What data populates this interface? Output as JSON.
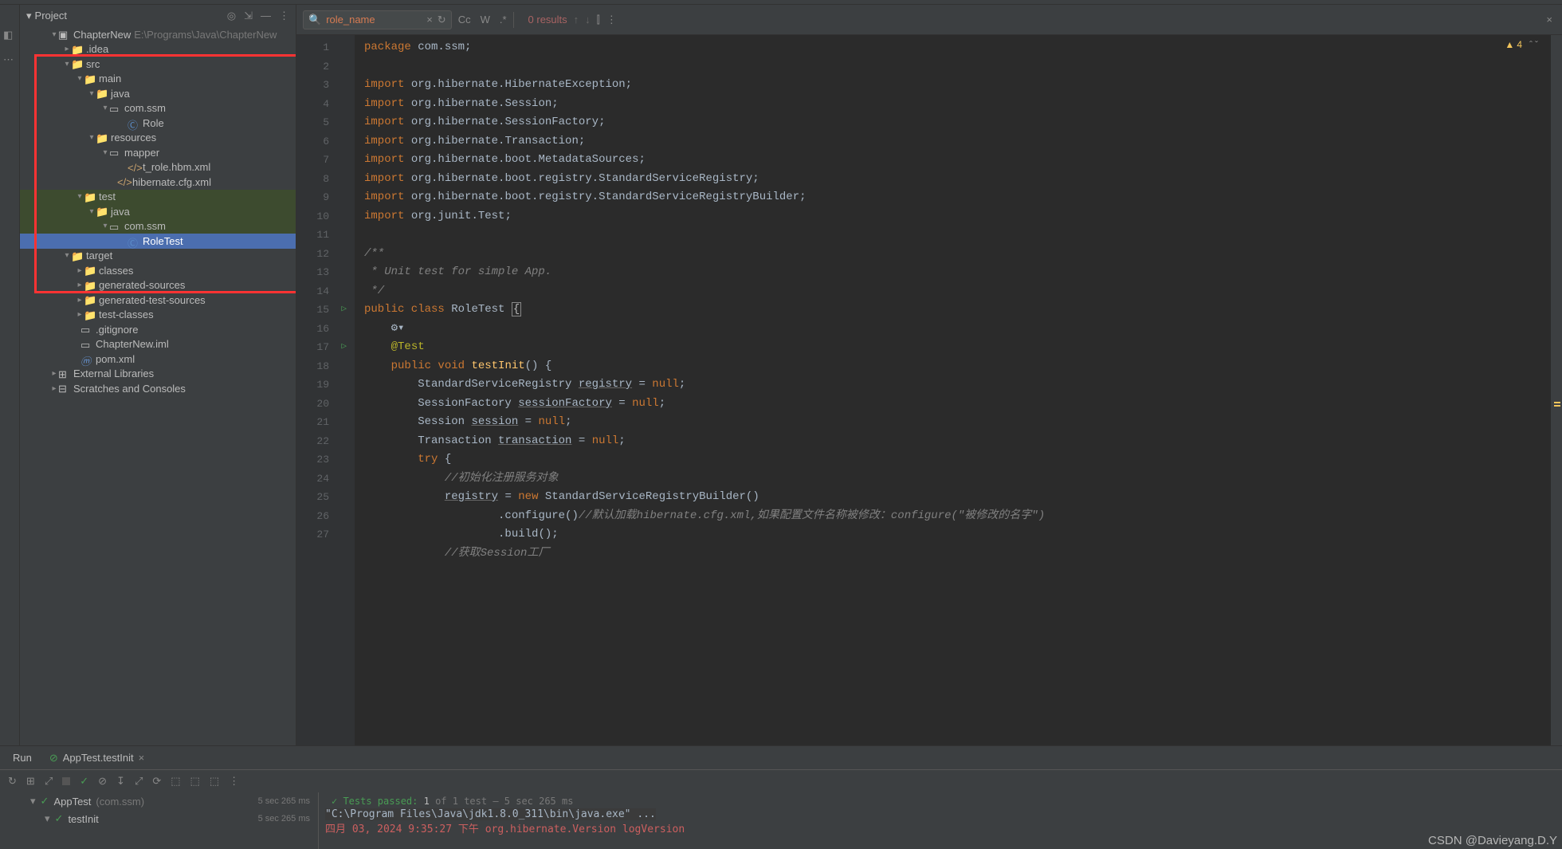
{
  "sidebar": {
    "header": "Project",
    "root": "ChapterNew",
    "root_path": "E:\\Programs\\Java\\ChapterNew",
    "nodes": [
      {
        "indent": 8,
        "arrow": "▾",
        "icon": "module",
        "label": "ChapterNew",
        "hint": "E:\\Programs\\Java\\ChapterNew"
      },
      {
        "indent": 24,
        "arrow": "▸",
        "icon": "folder",
        "label": ".idea"
      },
      {
        "indent": 24,
        "arrow": "▾",
        "icon": "folder-blue",
        "label": "src"
      },
      {
        "indent": 40,
        "arrow": "▾",
        "icon": "folder",
        "label": "main"
      },
      {
        "indent": 55,
        "arrow": "▾",
        "icon": "folder-blue",
        "label": "java"
      },
      {
        "indent": 72,
        "arrow": "▾",
        "icon": "package",
        "label": "com.ssm"
      },
      {
        "indent": 95,
        "arrow": "",
        "icon": "class",
        "label": "Role"
      },
      {
        "indent": 55,
        "arrow": "▾",
        "icon": "folder-yellow",
        "label": "resources"
      },
      {
        "indent": 72,
        "arrow": "▾",
        "icon": "package",
        "label": "mapper"
      },
      {
        "indent": 95,
        "arrow": "",
        "icon": "xml",
        "label": "t_role.hbm.xml"
      },
      {
        "indent": 82,
        "arrow": "",
        "icon": "xml",
        "label": "hibernate.cfg.xml"
      },
      {
        "indent": 40,
        "arrow": "▾",
        "icon": "folder",
        "label": "test",
        "hl": "test"
      },
      {
        "indent": 55,
        "arrow": "▾",
        "icon": "folder-green",
        "label": "java",
        "hl": "test"
      },
      {
        "indent": 72,
        "arrow": "▾",
        "icon": "package",
        "label": "com.ssm",
        "hl": "test"
      },
      {
        "indent": 95,
        "arrow": "",
        "icon": "class",
        "label": "RoleTest",
        "selected": true
      },
      {
        "indent": 24,
        "arrow": "▾",
        "icon": "folder-orange",
        "label": "target"
      },
      {
        "indent": 40,
        "arrow": "▸",
        "icon": "folder",
        "label": "classes"
      },
      {
        "indent": 40,
        "arrow": "▸",
        "icon": "folder",
        "label": "generated-sources"
      },
      {
        "indent": 40,
        "arrow": "▸",
        "icon": "folder",
        "label": "generated-test-sources"
      },
      {
        "indent": 40,
        "arrow": "▸",
        "icon": "folder",
        "label": "test-classes"
      },
      {
        "indent": 36,
        "arrow": "",
        "icon": "file",
        "label": ".gitignore"
      },
      {
        "indent": 36,
        "arrow": "",
        "icon": "iml",
        "label": "ChapterNew.iml"
      },
      {
        "indent": 36,
        "arrow": "",
        "icon": "maven",
        "label": "pom.xml"
      },
      {
        "indent": 8,
        "arrow": "▸",
        "icon": "lib",
        "label": "External Libraries"
      },
      {
        "indent": 8,
        "arrow": "▸",
        "icon": "scratch",
        "label": "Scratches and Consoles"
      }
    ]
  },
  "find": {
    "query": "role_name",
    "results": "0 results",
    "opts": {
      "cc": "Cc",
      "w": "W",
      "regex": ".*"
    }
  },
  "inspection": {
    "warnings": "4"
  },
  "code": {
    "lines": [
      {
        "n": "1",
        "html": "<span class='kw'>package</span> <span class='txt'>com.ssm;</span>"
      },
      {
        "n": "2",
        "html": ""
      },
      {
        "n": "3",
        "html": "<span class='kw'>import</span> <span class='txt'>org.hibernate.HibernateException;</span>"
      },
      {
        "n": "4",
        "html": "<span class='kw'>import</span> <span class='txt'>org.hibernate.Session;</span>"
      },
      {
        "n": "5",
        "html": "<span class='kw'>import</span> <span class='txt'>org.hibernate.SessionFactory;</span>"
      },
      {
        "n": "6",
        "html": "<span class='kw'>import</span> <span class='txt'>org.hibernate.Transaction;</span>"
      },
      {
        "n": "7",
        "html": "<span class='kw'>import</span> <span class='txt'>org.hibernate.boot.MetadataSources;</span>"
      },
      {
        "n": "8",
        "html": "<span class='kw'>import</span> <span class='txt'>org.hibernate.boot.registry.StandardServiceRegistry;</span>"
      },
      {
        "n": "9",
        "html": "<span class='kw'>import</span> <span class='txt'>org.hibernate.boot.registry.StandardServiceRegistryBuilder;</span>"
      },
      {
        "n": "10",
        "html": "<span class='kw'>import</span> <span class='txt'>org.junit.Test;</span>"
      },
      {
        "n": "11",
        "html": ""
      },
      {
        "n": "12",
        "html": "<span class='cm'>/**</span>"
      },
      {
        "n": "13",
        "html": "<span class='cm'> * Unit test for simple App.</span>"
      },
      {
        "n": "14",
        "html": "<span class='cm'> */</span>"
      },
      {
        "n": "15",
        "run": true,
        "html": "<span class='kw'>public class</span> <span class='txt'>RoleTest </span><span class='cursor-box'>{</span>"
      },
      {
        "n": "  ",
        "html": "    <span class='txt'>&#9881;&#9662;</span>"
      },
      {
        "n": "16",
        "html": "    <span class='an'>@Test</span>"
      },
      {
        "n": "17",
        "run": true,
        "html": "    <span class='kw'>public void</span> <span class='fn'>testInit</span><span class='txt'>() {</span>"
      },
      {
        "n": "18",
        "html": "        <span class='txt'>StandardServiceRegistry </span><span class='var-u'>registry</span><span class='txt'> = </span><span class='kw'>null</span><span class='txt'>;</span>"
      },
      {
        "n": "19",
        "html": "        <span class='txt'>SessionFactory </span><span class='var-u'>sessionFactory</span><span class='txt'> = </span><span class='kw'>null</span><span class='txt'>;</span>"
      },
      {
        "n": "20",
        "html": "        <span class='txt'>Session </span><span class='var-u'>session</span><span class='txt'> = </span><span class='kw'>null</span><span class='txt'>;</span>"
      },
      {
        "n": "21",
        "html": "        <span class='txt'>Transaction </span><span class='var-u'>transaction</span><span class='txt'> = </span><span class='kw'>null</span><span class='txt'>;</span>"
      },
      {
        "n": "22",
        "html": "        <span class='kw'>try</span><span class='txt'> {</span>"
      },
      {
        "n": "23",
        "html": "            <span class='cm'>//初始化注册服务对象</span>"
      },
      {
        "n": "24",
        "html": "            <span class='var-u'>registry</span><span class='txt'> = </span><span class='kw'>new</span><span class='txt'> StandardServiceRegistryBuilder()</span>"
      },
      {
        "n": "25",
        "html": "                    <span class='txt'>.configure()</span><span class='cm'>//默认加载hibernate.cfg.xml,如果配置文件名称被修改：configure(\"被修改的名字\")</span>"
      },
      {
        "n": "26",
        "html": "                    <span class='txt'>.build();</span>"
      },
      {
        "n": "27",
        "html": "            <span class='cm'>//获取Session工厂</span>"
      }
    ]
  },
  "bottom": {
    "tabs": {
      "run": "Run",
      "test": "AppTest.testInit"
    },
    "tests_passed": {
      "prefix": "Tests passed: ",
      "count": "1",
      "suffix": " of 1 test – 5 sec 265 ms"
    },
    "tests": [
      {
        "name": "AppTest",
        "pkg": "(com.ssm)",
        "time": "5 sec 265 ms"
      },
      {
        "name": "testInit",
        "pkg": "",
        "time": "5 sec 265 ms"
      }
    ],
    "console": {
      "line1": "\"C:\\Program Files\\Java\\jdk1.8.0_311\\bin\\java.exe\" ...",
      "line2_date": "四月 03, 2024 9:35:27 下午",
      "line2_class": " org.hibernate.Version logVersion"
    }
  },
  "watermark": "CSDN @Davieyang.D.Y"
}
